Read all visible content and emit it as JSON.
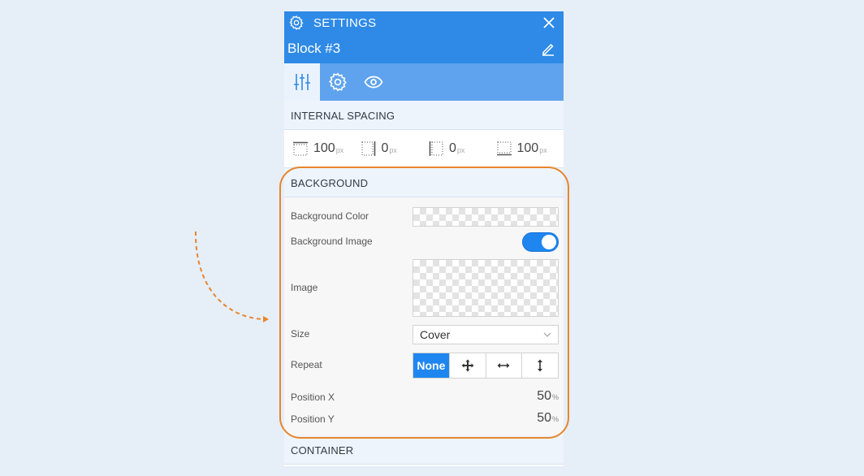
{
  "header": {
    "title": "SETTINGS",
    "block_name": "Block #3"
  },
  "tabs": [
    {
      "name": "layout",
      "icon": "sliders-icon",
      "active": true
    },
    {
      "name": "settings",
      "icon": "gear-icon",
      "active": false
    },
    {
      "name": "visibility",
      "icon": "eye-icon",
      "active": false
    }
  ],
  "internal_spacing": {
    "title": "INTERNAL SPACING",
    "unit": "px",
    "top": "100",
    "right": "0",
    "left": "0",
    "bottom": "100"
  },
  "background": {
    "title": "BACKGROUND",
    "color_label": "Background Color",
    "image_toggle_label": "Background Image",
    "image_toggle_on": true,
    "image_label": "Image",
    "size_label": "Size",
    "size_value": "Cover",
    "repeat_label": "Repeat",
    "repeat_none": "None",
    "position_x_label": "Position X",
    "position_x_value": "50",
    "position_y_label": "Position Y",
    "position_y_value": "50",
    "position_unit": "%"
  },
  "container": {
    "title": "CONTAINER"
  },
  "colors": {
    "header_blue": "#2e8ae6",
    "tab_bar_blue": "#5fa3ee",
    "accent_blue": "#1f86f0",
    "highlight_orange": "#e8852d"
  }
}
